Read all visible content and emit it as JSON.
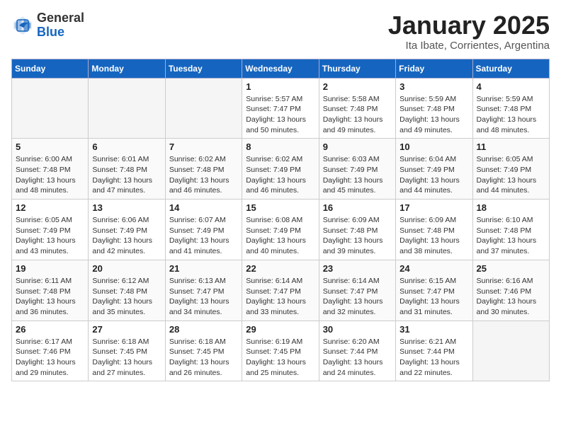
{
  "header": {
    "logo_general": "General",
    "logo_blue": "Blue",
    "title": "January 2025",
    "subtitle": "Ita Ibate, Corrientes, Argentina"
  },
  "weekdays": [
    "Sunday",
    "Monday",
    "Tuesday",
    "Wednesday",
    "Thursday",
    "Friday",
    "Saturday"
  ],
  "weeks": [
    [
      {
        "day": "",
        "info": ""
      },
      {
        "day": "",
        "info": ""
      },
      {
        "day": "",
        "info": ""
      },
      {
        "day": "1",
        "info": "Sunrise: 5:57 AM\nSunset: 7:47 PM\nDaylight: 13 hours\nand 50 minutes."
      },
      {
        "day": "2",
        "info": "Sunrise: 5:58 AM\nSunset: 7:48 PM\nDaylight: 13 hours\nand 49 minutes."
      },
      {
        "day": "3",
        "info": "Sunrise: 5:59 AM\nSunset: 7:48 PM\nDaylight: 13 hours\nand 49 minutes."
      },
      {
        "day": "4",
        "info": "Sunrise: 5:59 AM\nSunset: 7:48 PM\nDaylight: 13 hours\nand 48 minutes."
      }
    ],
    [
      {
        "day": "5",
        "info": "Sunrise: 6:00 AM\nSunset: 7:48 PM\nDaylight: 13 hours\nand 48 minutes."
      },
      {
        "day": "6",
        "info": "Sunrise: 6:01 AM\nSunset: 7:48 PM\nDaylight: 13 hours\nand 47 minutes."
      },
      {
        "day": "7",
        "info": "Sunrise: 6:02 AM\nSunset: 7:48 PM\nDaylight: 13 hours\nand 46 minutes."
      },
      {
        "day": "8",
        "info": "Sunrise: 6:02 AM\nSunset: 7:49 PM\nDaylight: 13 hours\nand 46 minutes."
      },
      {
        "day": "9",
        "info": "Sunrise: 6:03 AM\nSunset: 7:49 PM\nDaylight: 13 hours\nand 45 minutes."
      },
      {
        "day": "10",
        "info": "Sunrise: 6:04 AM\nSunset: 7:49 PM\nDaylight: 13 hours\nand 44 minutes."
      },
      {
        "day": "11",
        "info": "Sunrise: 6:05 AM\nSunset: 7:49 PM\nDaylight: 13 hours\nand 44 minutes."
      }
    ],
    [
      {
        "day": "12",
        "info": "Sunrise: 6:05 AM\nSunset: 7:49 PM\nDaylight: 13 hours\nand 43 minutes."
      },
      {
        "day": "13",
        "info": "Sunrise: 6:06 AM\nSunset: 7:49 PM\nDaylight: 13 hours\nand 42 minutes."
      },
      {
        "day": "14",
        "info": "Sunrise: 6:07 AM\nSunset: 7:49 PM\nDaylight: 13 hours\nand 41 minutes."
      },
      {
        "day": "15",
        "info": "Sunrise: 6:08 AM\nSunset: 7:49 PM\nDaylight: 13 hours\nand 40 minutes."
      },
      {
        "day": "16",
        "info": "Sunrise: 6:09 AM\nSunset: 7:48 PM\nDaylight: 13 hours\nand 39 minutes."
      },
      {
        "day": "17",
        "info": "Sunrise: 6:09 AM\nSunset: 7:48 PM\nDaylight: 13 hours\nand 38 minutes."
      },
      {
        "day": "18",
        "info": "Sunrise: 6:10 AM\nSunset: 7:48 PM\nDaylight: 13 hours\nand 37 minutes."
      }
    ],
    [
      {
        "day": "19",
        "info": "Sunrise: 6:11 AM\nSunset: 7:48 PM\nDaylight: 13 hours\nand 36 minutes."
      },
      {
        "day": "20",
        "info": "Sunrise: 6:12 AM\nSunset: 7:48 PM\nDaylight: 13 hours\nand 35 minutes."
      },
      {
        "day": "21",
        "info": "Sunrise: 6:13 AM\nSunset: 7:47 PM\nDaylight: 13 hours\nand 34 minutes."
      },
      {
        "day": "22",
        "info": "Sunrise: 6:14 AM\nSunset: 7:47 PM\nDaylight: 13 hours\nand 33 minutes."
      },
      {
        "day": "23",
        "info": "Sunrise: 6:14 AM\nSunset: 7:47 PM\nDaylight: 13 hours\nand 32 minutes."
      },
      {
        "day": "24",
        "info": "Sunrise: 6:15 AM\nSunset: 7:47 PM\nDaylight: 13 hours\nand 31 minutes."
      },
      {
        "day": "25",
        "info": "Sunrise: 6:16 AM\nSunset: 7:46 PM\nDaylight: 13 hours\nand 30 minutes."
      }
    ],
    [
      {
        "day": "26",
        "info": "Sunrise: 6:17 AM\nSunset: 7:46 PM\nDaylight: 13 hours\nand 29 minutes."
      },
      {
        "day": "27",
        "info": "Sunrise: 6:18 AM\nSunset: 7:45 PM\nDaylight: 13 hours\nand 27 minutes."
      },
      {
        "day": "28",
        "info": "Sunrise: 6:18 AM\nSunset: 7:45 PM\nDaylight: 13 hours\nand 26 minutes."
      },
      {
        "day": "29",
        "info": "Sunrise: 6:19 AM\nSunset: 7:45 PM\nDaylight: 13 hours\nand 25 minutes."
      },
      {
        "day": "30",
        "info": "Sunrise: 6:20 AM\nSunset: 7:44 PM\nDaylight: 13 hours\nand 24 minutes."
      },
      {
        "day": "31",
        "info": "Sunrise: 6:21 AM\nSunset: 7:44 PM\nDaylight: 13 hours\nand 22 minutes."
      },
      {
        "day": "",
        "info": ""
      }
    ]
  ]
}
